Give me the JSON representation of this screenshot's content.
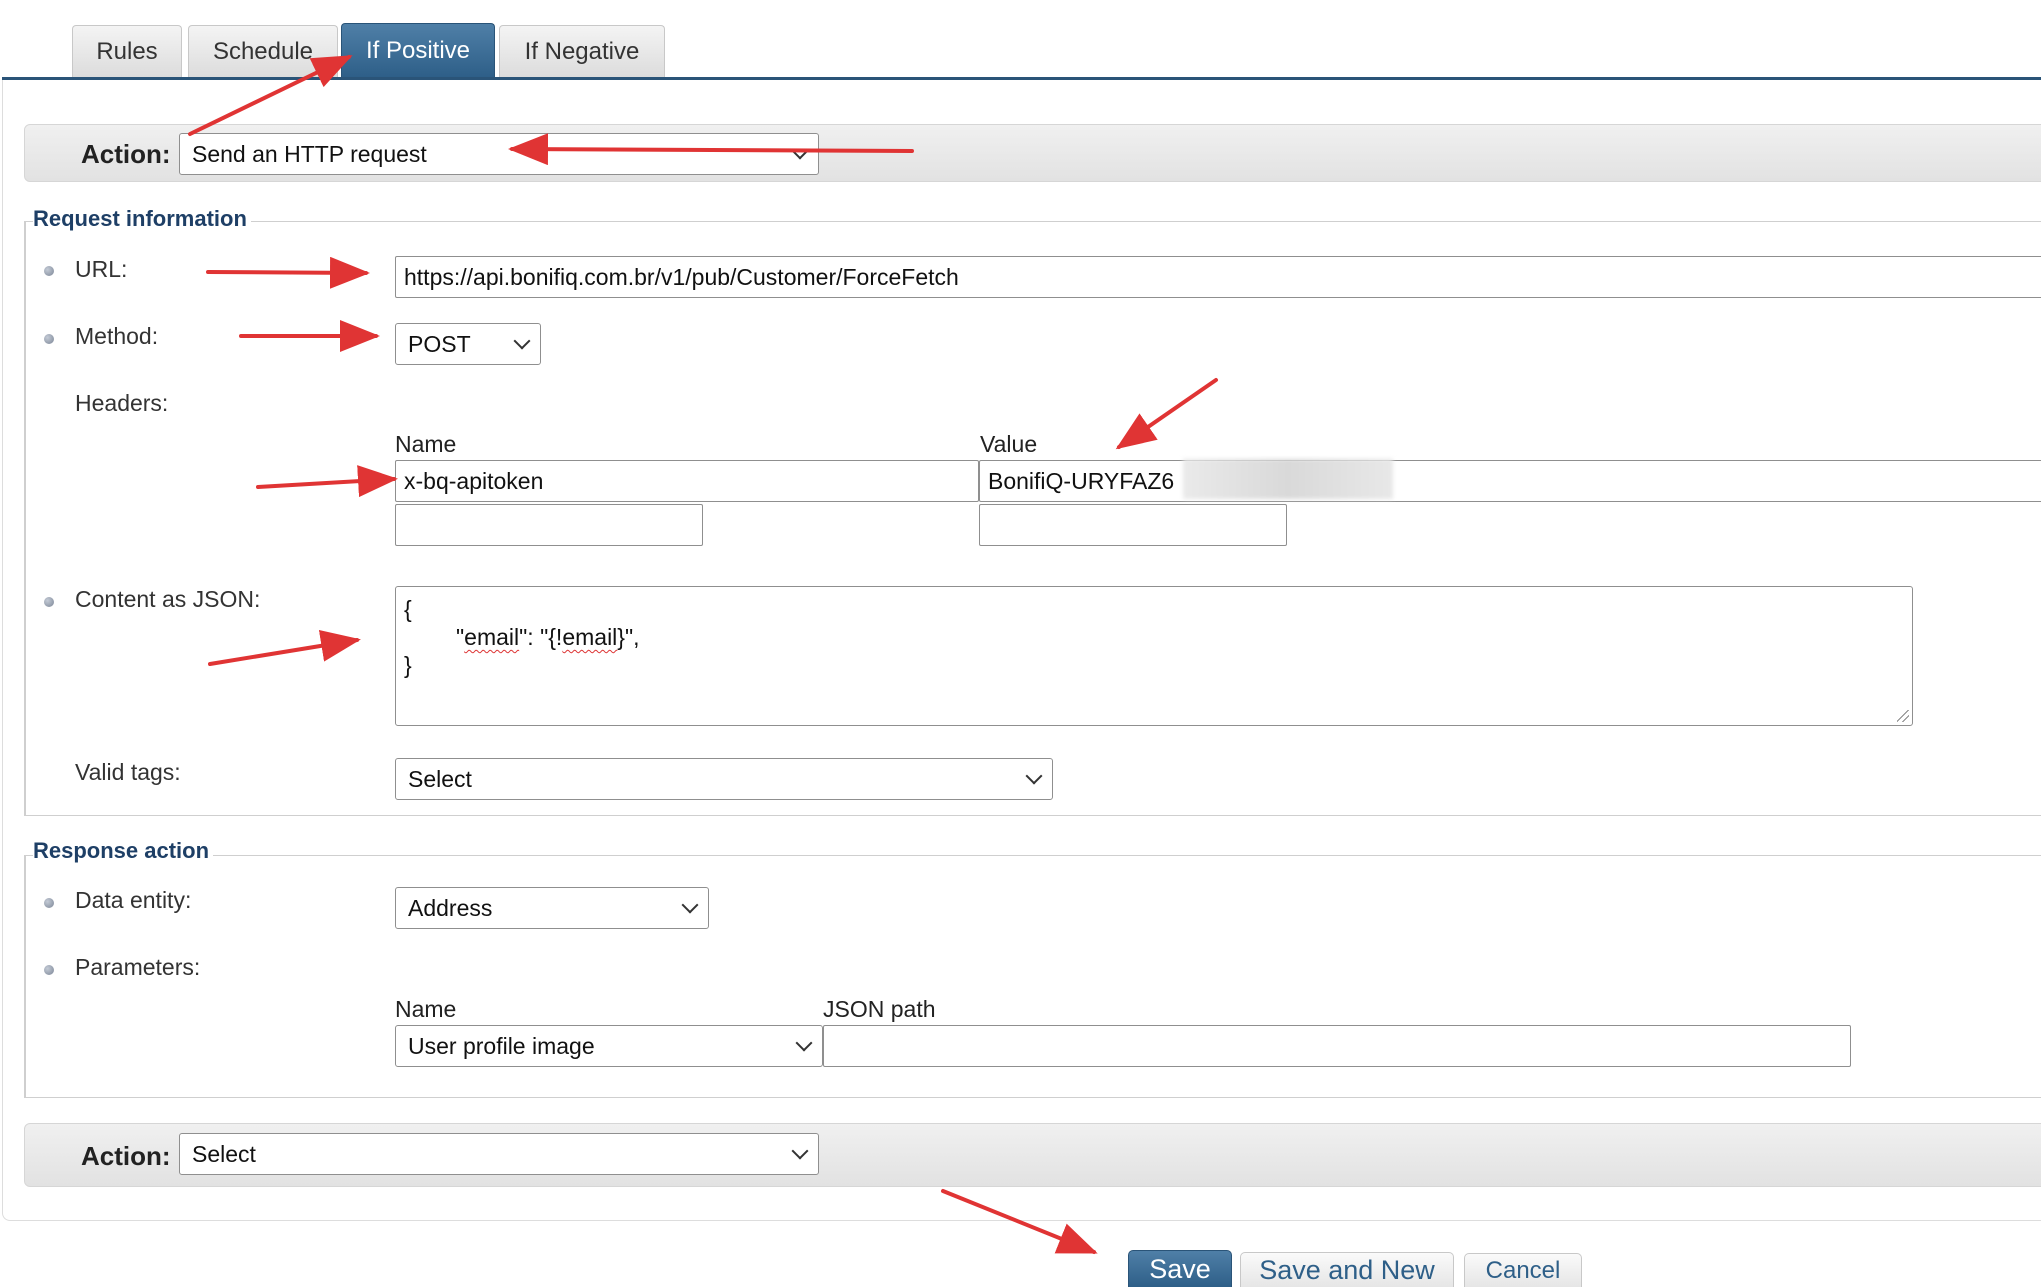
{
  "tabs": [
    {
      "label": "Rules",
      "active": false
    },
    {
      "label": "Schedule",
      "active": false
    },
    {
      "label": "If Positive",
      "active": true
    },
    {
      "label": "If Negative",
      "active": false
    }
  ],
  "action_top": {
    "label": "Action:",
    "value": "Send an HTTP request"
  },
  "request": {
    "legend": "Request information",
    "url_label": "URL:",
    "url_value": "https://api.bonifiq.com.br/v1/pub/Customer/ForceFetch",
    "method_label": "Method:",
    "method_value": "POST",
    "headers_label": "Headers:",
    "headers_name_col": "Name",
    "headers_value_col": "Value",
    "header_rows": [
      {
        "name": "x-bq-apitoken",
        "value": "BonifiQ-URYFAZ6"
      },
      {
        "name": "",
        "value": ""
      }
    ],
    "content_label": "Content as JSON:",
    "content_lines": [
      "{",
      "\"email\": \"{!email}\",",
      "}"
    ],
    "content_key": "email",
    "content_token": "email",
    "valid_tags_label": "Valid tags:",
    "valid_tags_value": "Select"
  },
  "response": {
    "legend": "Response action",
    "data_entity_label": "Data entity:",
    "data_entity_value": "Address",
    "parameters_label": "Parameters:",
    "param_name_col": "Name",
    "param_path_col": "JSON path",
    "param_name_value": "User profile image",
    "param_path_value": ""
  },
  "action_bottom": {
    "label": "Action:",
    "value": "Select"
  },
  "buttons": {
    "save": "Save",
    "save_new": "Save and New",
    "cancel": "Cancel"
  },
  "colors": {
    "accent": "#2e5f88",
    "legend": "#1e3f66",
    "annotation_arrow": "#e03434"
  }
}
